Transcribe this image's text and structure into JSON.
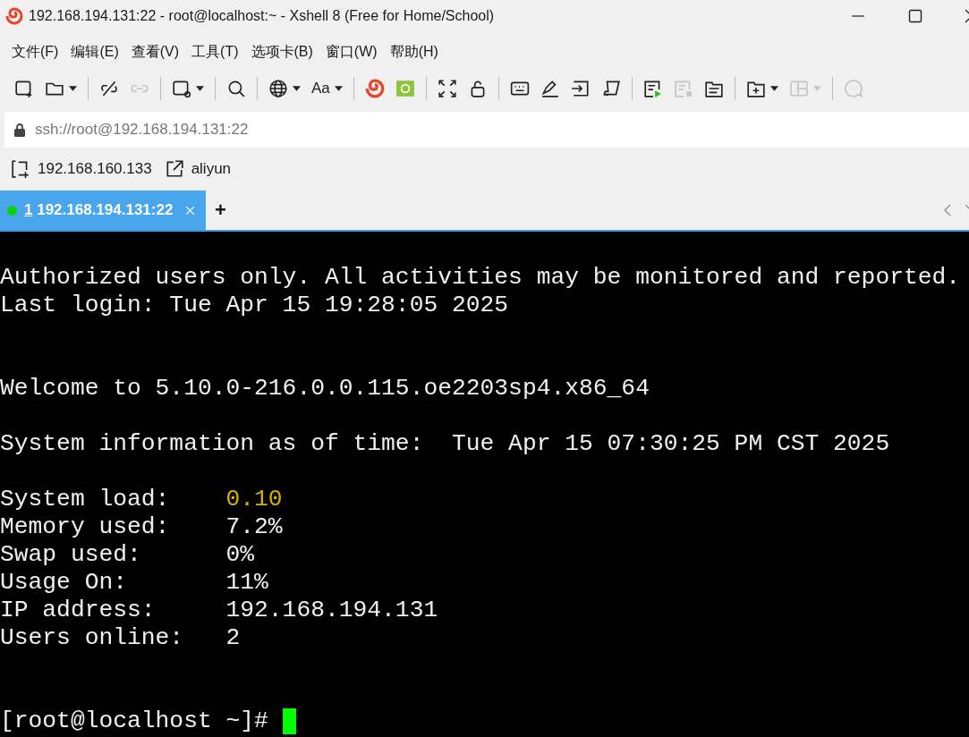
{
  "window": {
    "title": "192.168.194.131:22 - root@localhost:~ - Xshell 8 (Free for Home/School)"
  },
  "menu": [
    "文件(F)",
    "编辑(E)",
    "查看(V)",
    "工具(T)",
    "选项卡(B)",
    "窗口(W)",
    "帮助(H)"
  ],
  "toolbar": [
    [
      {
        "dropdown": false,
        "disabled": false
      },
      {
        "dropdown": true,
        "disabled": false
      }
    ],
    [
      {
        "dropdown": false,
        "disabled": false
      },
      {
        "dropdown": false,
        "disabled": true
      }
    ],
    [
      {
        "dropdown": true,
        "disabled": false
      }
    ],
    [
      {
        "dropdown": false,
        "disabled": false
      }
    ],
    [
      {
        "dropdown": true,
        "disabled": false
      },
      {
        "dropdown": true,
        "disabled": false,
        "text": "Aa"
      }
    ],
    [
      {
        "dropdown": false,
        "disabled": false
      },
      {
        "dropdown": false,
        "disabled": false
      }
    ],
    [
      {
        "dropdown": false,
        "disabled": false
      },
      {
        "dropdown": false,
        "disabled": false
      }
    ],
    [
      {
        "dropdown": false,
        "disabled": false
      },
      {
        "dropdown": false,
        "disabled": false
      },
      {
        "dropdown": false,
        "disabled": false
      },
      {
        "dropdown": false,
        "disabled": false
      }
    ],
    [
      {
        "dropdown": false,
        "disabled": false
      },
      {
        "dropdown": false,
        "disabled": true
      },
      {
        "dropdown": false,
        "disabled": false
      }
    ],
    [
      {
        "dropdown": true,
        "disabled": false
      },
      {
        "dropdown": true,
        "disabled": true
      }
    ],
    [
      {
        "dropdown": false,
        "disabled": true
      }
    ]
  ],
  "address": {
    "value": "ssh://root@192.168.194.131:22"
  },
  "quick_bar": [
    {
      "kind": "session",
      "label": "192.168.160.133"
    },
    {
      "kind": "link",
      "label": "aliyun"
    }
  ],
  "tabs": [
    {
      "number": "1",
      "label": "192.168.194.131:22",
      "selected": true,
      "connected": true
    }
  ],
  "new_tab": "+",
  "terminal": [
    {
      "kind": "text",
      "segments": [
        {
          "text": "Authorized users only. All activities may be monitored and reported."
        }
      ]
    },
    {
      "kind": "text",
      "segments": [
        {
          "text": "Last login: Tue Apr 15 19:28:05 2025"
        }
      ]
    },
    {
      "kind": "blank"
    },
    {
      "kind": "blank"
    },
    {
      "kind": "text",
      "segments": [
        {
          "text": "Welcome to 5.10.0-216.0.0.115.oe2203sp4.x86_64"
        }
      ]
    },
    {
      "kind": "blank"
    },
    {
      "kind": "text",
      "segments": [
        {
          "text": "System information as of time:  Tue Apr 15 07:30:25 PM CST 2025"
        }
      ]
    },
    {
      "kind": "blank"
    },
    {
      "kind": "text",
      "segments": [
        {
          "text": "System load:    "
        },
        {
          "text": "0.10",
          "color": "#d8b000"
        }
      ]
    },
    {
      "kind": "text",
      "segments": [
        {
          "text": "Memory used:    7.2%"
        }
      ]
    },
    {
      "kind": "text",
      "segments": [
        {
          "text": "Swap used:      0%"
        }
      ]
    },
    {
      "kind": "text",
      "segments": [
        {
          "text": "Usage On:       11%"
        }
      ]
    },
    {
      "kind": "text",
      "segments": [
        {
          "text": "IP address:     192.168.194.131"
        }
      ]
    },
    {
      "kind": "text",
      "segments": [
        {
          "text": "Users online:   2"
        }
      ]
    },
    {
      "kind": "blank"
    },
    {
      "kind": "blank"
    },
    {
      "kind": "prompt",
      "segments": [
        {
          "text": "[root@localhost ~]# "
        }
      ]
    }
  ]
}
